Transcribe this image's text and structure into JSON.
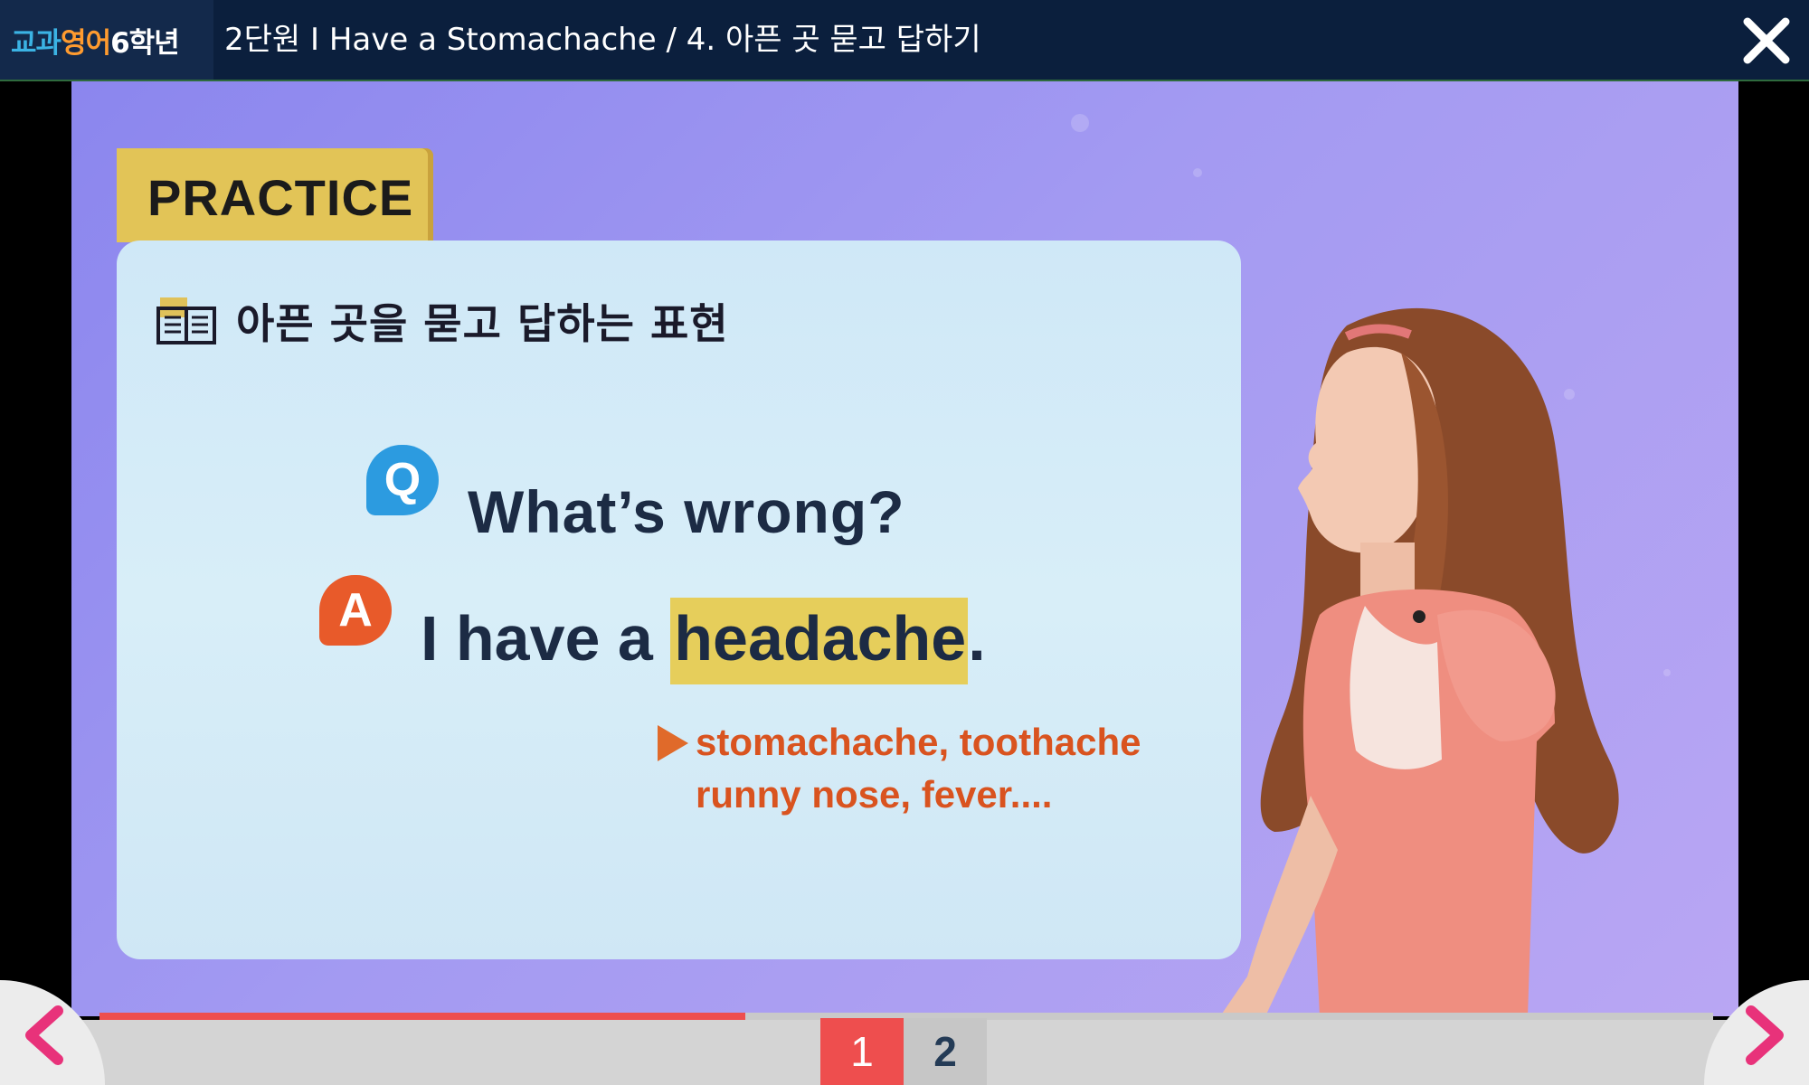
{
  "header": {
    "brand_parts": [
      {
        "text": "교과",
        "color": "#3bb3e4"
      },
      {
        "text": " ",
        "color": "#ffffff"
      },
      {
        "text": "영어",
        "color": "#ff9b2f"
      },
      {
        "text": " ",
        "color": "#ffffff"
      },
      {
        "text": "6학년",
        "color": "#ffffff"
      }
    ],
    "title": "2단원 I Have a Stomachache / 4. 아픈 곳 묻고 답하기",
    "close_icon": "close-icon"
  },
  "slide": {
    "tab_label": "PRACTICE",
    "board_title": "아픈 곳을 묻고 답하는 표현",
    "q_badge": "Q",
    "question": "What’s wrong?",
    "a_badge": "A",
    "answer_prefix": "I have a ",
    "answer_highlight": "headache",
    "answer_suffix": ".",
    "hint_line1": "stomachache, toothache",
    "hint_line2": "runny nose, fever....",
    "colors": {
      "highlight": "#e6ce5b",
      "q_badge": "#2c9be0",
      "a_badge": "#e85a2a",
      "hint": "#d9531f"
    }
  },
  "player": {
    "progress": 0.4,
    "pages": [
      "1",
      "2"
    ],
    "current_page": "1",
    "prev_icon": "chevron-left-icon",
    "next_icon": "chevron-right-icon",
    "accent": "#ee4e4e"
  }
}
